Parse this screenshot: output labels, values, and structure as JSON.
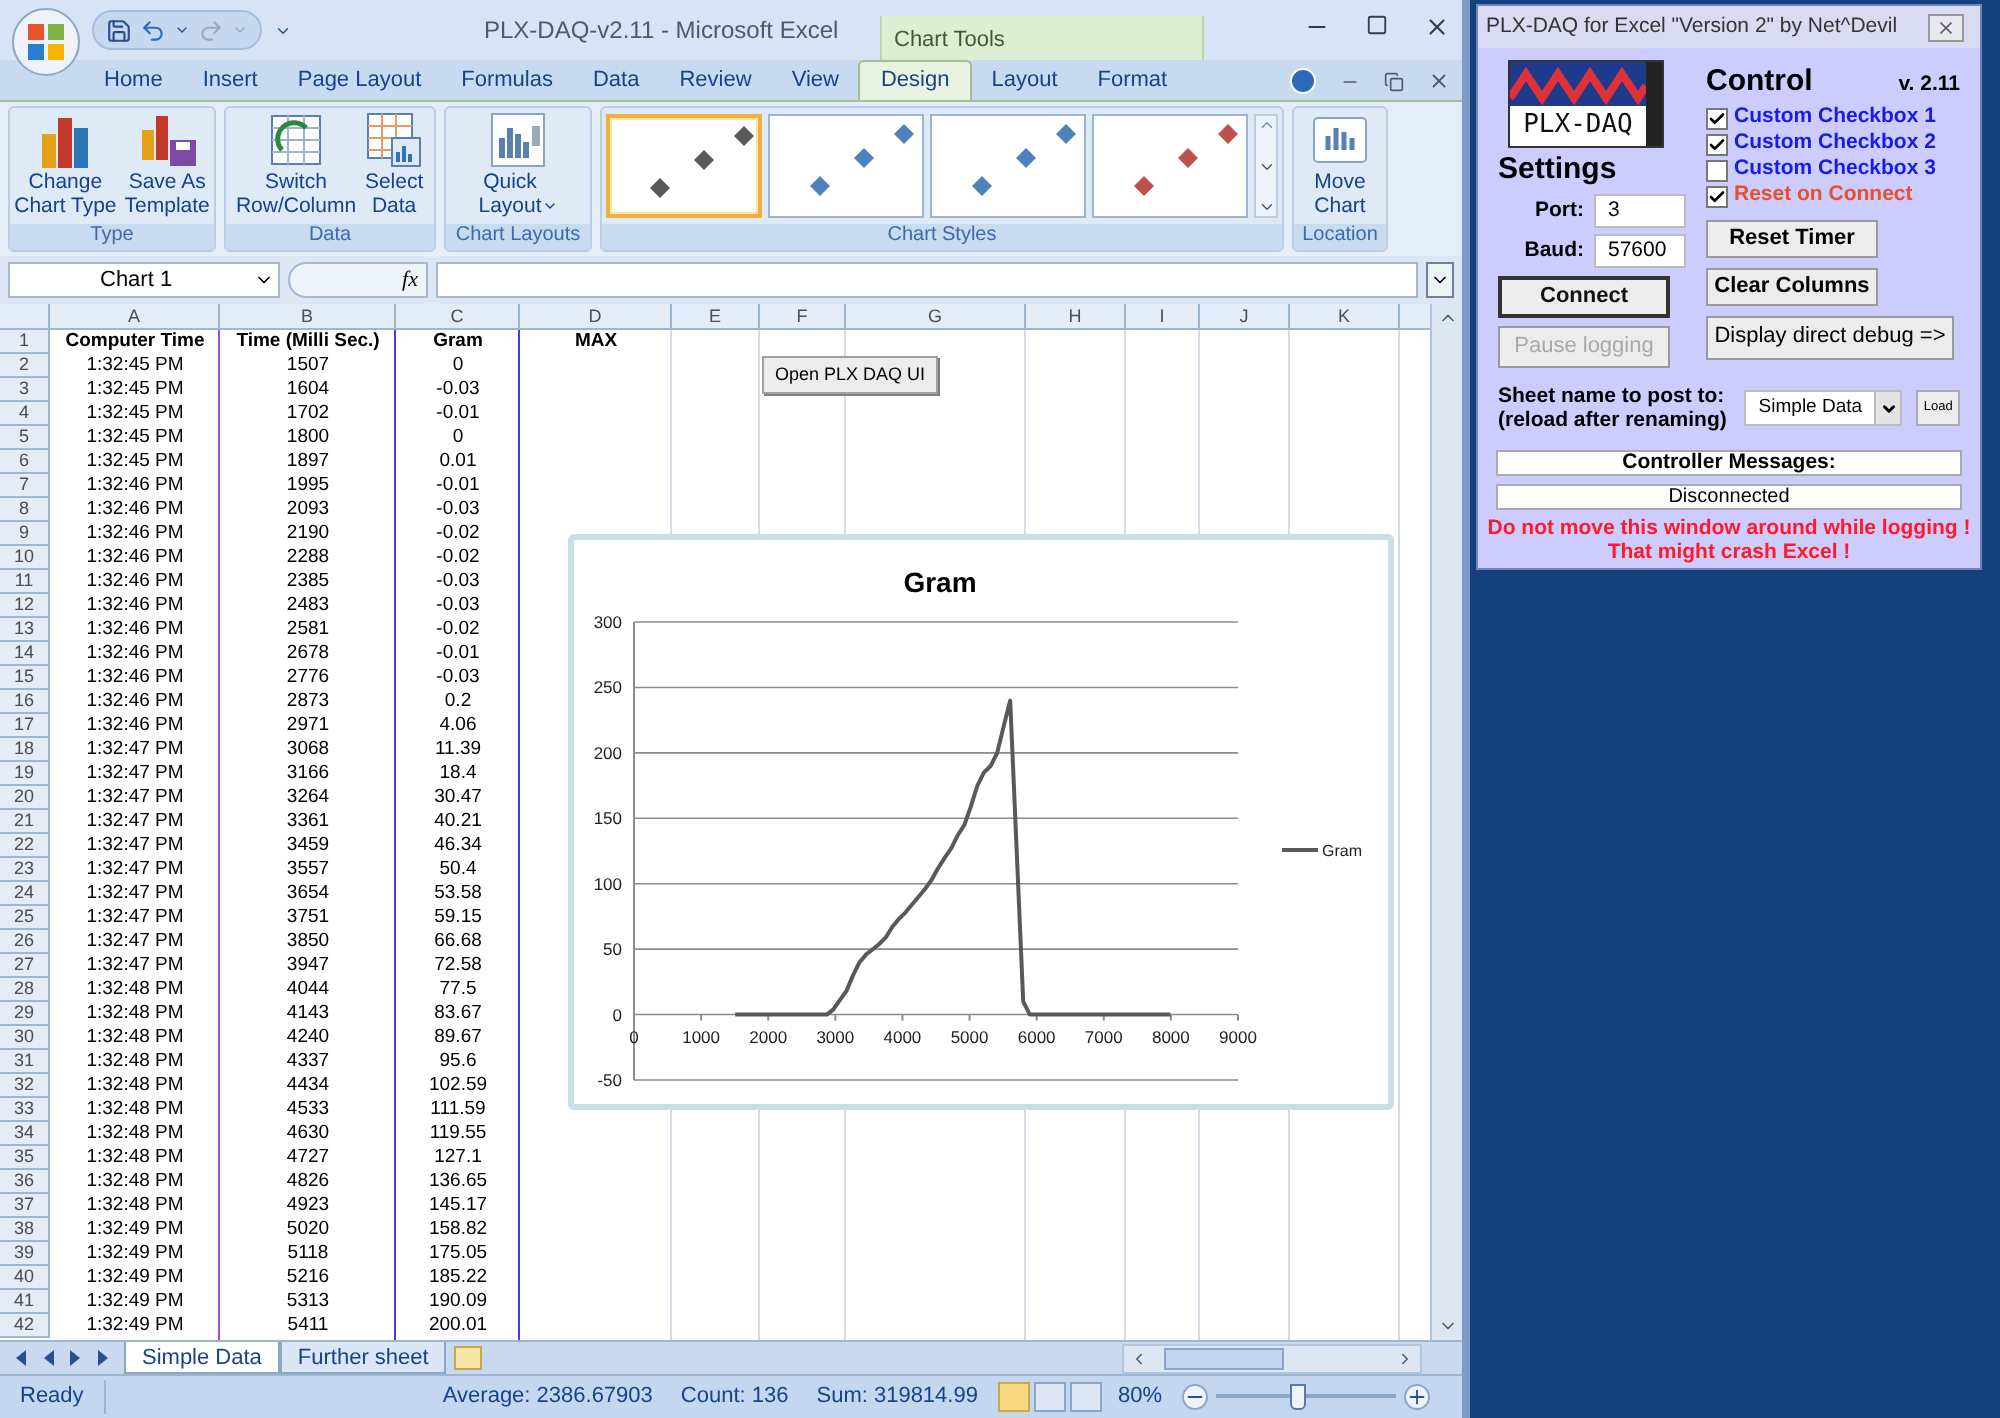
{
  "excel": {
    "title": "PLX-DAQ-v2.11 - Microsoft Excel",
    "contextual_group": "Chart Tools",
    "tabs": [
      {
        "label": "Home",
        "selected": false
      },
      {
        "label": "Insert",
        "selected": false
      },
      {
        "label": "Page Layout",
        "selected": false
      },
      {
        "label": "Formulas",
        "selected": false
      },
      {
        "label": "Data",
        "selected": false
      },
      {
        "label": "Review",
        "selected": false
      },
      {
        "label": "View",
        "selected": false
      },
      {
        "label": "Design",
        "selected": true
      },
      {
        "label": "Layout",
        "selected": false
      },
      {
        "label": "Format",
        "selected": false
      }
    ],
    "ribbon_groups": [
      {
        "label": "Type",
        "buttons": [
          {
            "label": "Change\nChart Type",
            "kind": "chart_type"
          },
          {
            "label": "Save As\nTemplate",
            "kind": "template"
          }
        ]
      },
      {
        "label": "Data",
        "buttons": [
          {
            "label": "Switch\nRow/Column",
            "kind": "switch"
          },
          {
            "label": "Select\nData",
            "kind": "select"
          }
        ]
      },
      {
        "label": "Chart Layouts",
        "buttons": [
          {
            "label": "Quick\nLayout",
            "kind": "layout",
            "dropdown": true
          }
        ]
      },
      {
        "label": "Chart Styles",
        "styles": [
          {
            "color": "#595959",
            "selected": true
          },
          {
            "color": "#4f81bd",
            "selected": false
          },
          {
            "color": "#4f81bd",
            "selected": false
          },
          {
            "color": "#c0504d",
            "selected": false
          }
        ]
      },
      {
        "label": "Location",
        "buttons": [
          {
            "label": "Move\nChart",
            "kind": "move"
          }
        ]
      }
    ],
    "name_box": "Chart 1",
    "function_button": "fx",
    "columns": [
      "A",
      "B",
      "C",
      "D",
      "E",
      "F",
      "G",
      "H",
      "I",
      "J",
      "K"
    ],
    "header_row": {
      "n": "1",
      "cells": [
        "Computer Time",
        "Time (Milli Sec.)",
        "Gram",
        "MAX"
      ]
    },
    "rows": [
      {
        "n": "2",
        "cells": [
          "1:32:45 PM",
          "1507",
          "0"
        ]
      },
      {
        "n": "3",
        "cells": [
          "1:32:45 PM",
          "1604",
          "-0.03"
        ]
      },
      {
        "n": "4",
        "cells": [
          "1:32:45 PM",
          "1702",
          "-0.01"
        ]
      },
      {
        "n": "5",
        "cells": [
          "1:32:45 PM",
          "1800",
          "0"
        ]
      },
      {
        "n": "6",
        "cells": [
          "1:32:45 PM",
          "1897",
          "0.01"
        ]
      },
      {
        "n": "7",
        "cells": [
          "1:32:46 PM",
          "1995",
          "-0.01"
        ]
      },
      {
        "n": "8",
        "cells": [
          "1:32:46 PM",
          "2093",
          "-0.03"
        ]
      },
      {
        "n": "9",
        "cells": [
          "1:32:46 PM",
          "2190",
          "-0.02"
        ]
      },
      {
        "n": "10",
        "cells": [
          "1:32:46 PM",
          "2288",
          "-0.02"
        ]
      },
      {
        "n": "11",
        "cells": [
          "1:32:46 PM",
          "2385",
          "-0.03"
        ]
      },
      {
        "n": "12",
        "cells": [
          "1:32:46 PM",
          "2483",
          "-0.03"
        ]
      },
      {
        "n": "13",
        "cells": [
          "1:32:46 PM",
          "2581",
          "-0.02"
        ]
      },
      {
        "n": "14",
        "cells": [
          "1:32:46 PM",
          "2678",
          "-0.01"
        ]
      },
      {
        "n": "15",
        "cells": [
          "1:32:46 PM",
          "2776",
          "-0.03"
        ]
      },
      {
        "n": "16",
        "cells": [
          "1:32:46 PM",
          "2873",
          "0.2"
        ]
      },
      {
        "n": "17",
        "cells": [
          "1:32:46 PM",
          "2971",
          "4.06"
        ]
      },
      {
        "n": "18",
        "cells": [
          "1:32:47 PM",
          "3068",
          "11.39"
        ]
      },
      {
        "n": "19",
        "cells": [
          "1:32:47 PM",
          "3166",
          "18.4"
        ]
      },
      {
        "n": "20",
        "cells": [
          "1:32:47 PM",
          "3264",
          "30.47"
        ]
      },
      {
        "n": "21",
        "cells": [
          "1:32:47 PM",
          "3361",
          "40.21"
        ]
      },
      {
        "n": "22",
        "cells": [
          "1:32:47 PM",
          "3459",
          "46.34"
        ]
      },
      {
        "n": "23",
        "cells": [
          "1:32:47 PM",
          "3557",
          "50.4"
        ]
      },
      {
        "n": "24",
        "cells": [
          "1:32:47 PM",
          "3654",
          "53.58"
        ]
      },
      {
        "n": "25",
        "cells": [
          "1:32:47 PM",
          "3751",
          "59.15"
        ]
      },
      {
        "n": "26",
        "cells": [
          "1:32:47 PM",
          "3850",
          "66.68"
        ]
      },
      {
        "n": "27",
        "cells": [
          "1:32:47 PM",
          "3947",
          "72.58"
        ]
      },
      {
        "n": "28",
        "cells": [
          "1:32:48 PM",
          "4044",
          "77.5"
        ]
      },
      {
        "n": "29",
        "cells": [
          "1:32:48 PM",
          "4143",
          "83.67"
        ]
      },
      {
        "n": "30",
        "cells": [
          "1:32:48 PM",
          "4240",
          "89.67"
        ]
      },
      {
        "n": "31",
        "cells": [
          "1:32:48 PM",
          "4337",
          "95.6"
        ]
      },
      {
        "n": "32",
        "cells": [
          "1:32:48 PM",
          "4434",
          "102.59"
        ]
      },
      {
        "n": "33",
        "cells": [
          "1:32:48 PM",
          "4533",
          "111.59"
        ]
      },
      {
        "n": "34",
        "cells": [
          "1:32:48 PM",
          "4630",
          "119.55"
        ]
      },
      {
        "n": "35",
        "cells": [
          "1:32:48 PM",
          "4727",
          "127.1"
        ]
      },
      {
        "n": "36",
        "cells": [
          "1:32:48 PM",
          "4826",
          "136.65"
        ]
      },
      {
        "n": "37",
        "cells": [
          "1:32:48 PM",
          "4923",
          "145.17"
        ]
      },
      {
        "n": "38",
        "cells": [
          "1:32:49 PM",
          "5020",
          "158.82"
        ]
      },
      {
        "n": "39",
        "cells": [
          "1:32:49 PM",
          "5118",
          "175.05"
        ]
      },
      {
        "n": "40",
        "cells": [
          "1:32:49 PM",
          "5216",
          "185.22"
        ]
      },
      {
        "n": "41",
        "cells": [
          "1:32:49 PM",
          "5313",
          "190.09"
        ]
      },
      {
        "n": "42",
        "cells": [
          "1:32:49 PM",
          "5411",
          "200.01"
        ]
      }
    ],
    "sheet_button": "Open PLX DAQ UI",
    "chart": {
      "chart_data": {
        "type": "line",
        "title": "Gram",
        "grid": true,
        "xlim": [
          0,
          9000
        ],
        "ylim": [
          -50,
          300
        ],
        "xticks": [
          0,
          1000,
          2000,
          3000,
          4000,
          5000,
          6000,
          7000,
          8000,
          9000
        ],
        "yticks": [
          -50,
          0,
          50,
          100,
          150,
          200,
          250,
          300
        ],
        "x": [
          1507,
          1604,
          1702,
          1800,
          1897,
          1995,
          2093,
          2190,
          2288,
          2385,
          2483,
          2581,
          2678,
          2776,
          2873,
          2971,
          3068,
          3166,
          3264,
          3361,
          3459,
          3557,
          3654,
          3751,
          3850,
          3947,
          4044,
          4143,
          4240,
          4337,
          4434,
          4533,
          4630,
          4727,
          4826,
          4923,
          5020,
          5118,
          5216,
          5313,
          5411,
          5508,
          5606,
          5800,
          5898,
          7994
        ],
        "series": [
          {
            "name": "Gram",
            "color": "#595959",
            "values": [
              0,
              0,
              0,
              0,
              0,
              0,
              0,
              0,
              0,
              0,
              0,
              0,
              0,
              0,
              0,
              4,
              11,
              18,
              30,
              40,
              46,
              50,
              54,
              59,
              67,
              73,
              78,
              84,
              90,
              96,
              103,
              112,
              120,
              127,
              137,
              145,
              159,
              175,
              185,
              190,
              200,
              220,
              240,
              10,
              0,
              0
            ]
          }
        ]
      }
    },
    "sheet_tabs": [
      {
        "label": "Simple Data",
        "selected": true
      },
      {
        "label": "Further sheet",
        "selected": false
      }
    ],
    "status": {
      "mode": "Ready",
      "average": "Average: 2386.67903",
      "count": "Count: 136",
      "sum": "Sum: 319814.99",
      "zoom": "80%"
    },
    "zoom_slider": {
      "level": 0.45
    }
  },
  "plx": {
    "title": "PLX-DAQ for Excel \"Version 2\" by Net^Devil",
    "logo": "PLX-DAQ",
    "settings_heading": "Settings",
    "control_heading": "Control",
    "version": "v. 2.11",
    "fields": [
      {
        "label": "Port:",
        "value": "3"
      },
      {
        "label": "Baud:",
        "value": "57600"
      }
    ],
    "checkboxes": [
      {
        "label": "Custom Checkbox 1",
        "checked": true,
        "color": "#1a1aee"
      },
      {
        "label": "Custom Checkbox 2",
        "checked": true,
        "color": "#1a1aee"
      },
      {
        "label": "Custom Checkbox 3",
        "checked": false,
        "color": "#1a1aee"
      },
      {
        "label": "Reset on Connect",
        "checked": true,
        "color": "#e8502a"
      }
    ],
    "left_buttons": [
      {
        "label": "Connect",
        "default": true,
        "disabled": false
      },
      {
        "label": "Pause logging",
        "default": false,
        "disabled": true
      }
    ],
    "right_buttons": [
      {
        "label": "Reset Timer"
      },
      {
        "label": "Clear Columns"
      },
      {
        "label": "Display direct debug =>"
      }
    ],
    "sheet_label": "Sheet name to post to:\n(reload after renaming)",
    "sheet_select": "Simple Data",
    "load_button": "Load",
    "messages_heading": "Controller Messages:",
    "message": "Disconnected",
    "warning": "Do not move this window around while logging !\nThat might crash Excel !"
  }
}
